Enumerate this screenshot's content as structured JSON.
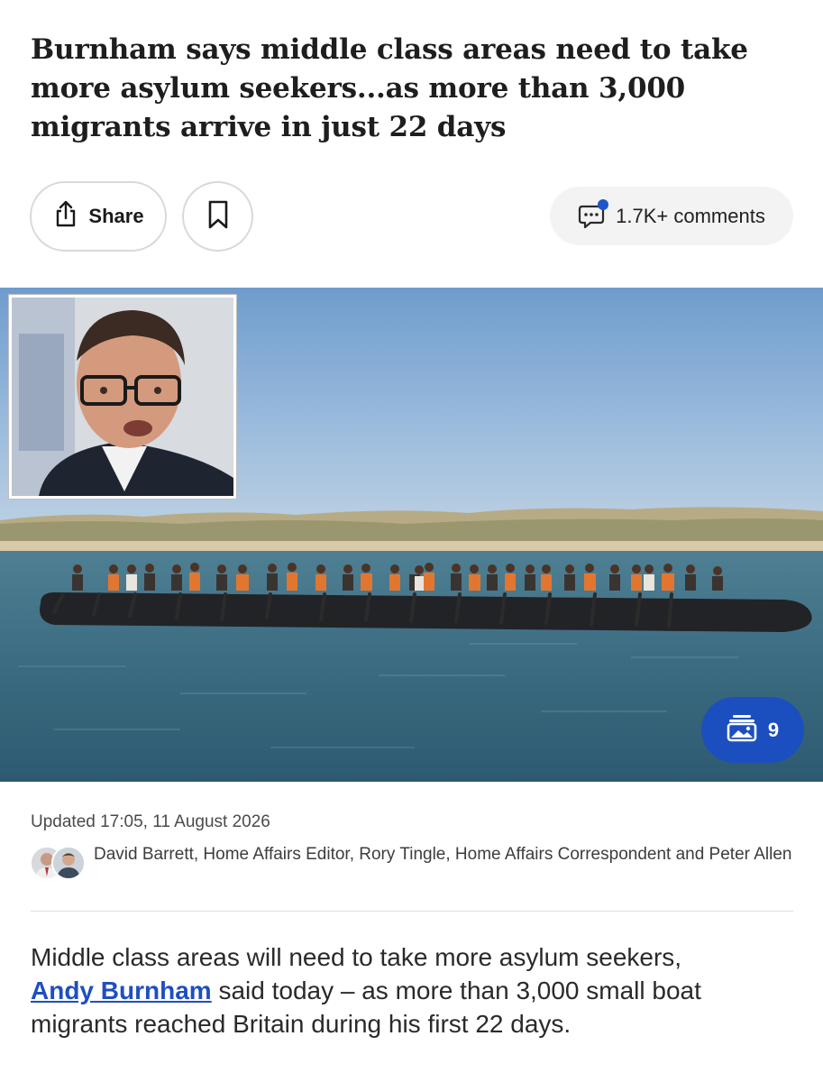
{
  "article": {
    "headline": "Burnham says middle class areas need to take more asylum seekers...as more than 3,000 migrants arrive in just 22 days",
    "updated": "Updated 17:05, 11 August 2026",
    "byline": "David Barrett, Home Affairs Editor, Rory Tingle, Home Affairs Correspondent and Peter Allen",
    "body_intro": "Middle class areas will need to take more asylum seekers,",
    "body_link": "Andy Burnham",
    "body_rest": " said today – as more than 3,000 small boat migrants reached Britain during his first 22 days."
  },
  "actions": {
    "share_label": "Share",
    "comments_label": "1.7K+ comments",
    "gallery_count": "9"
  },
  "icons": {
    "share": "share-icon",
    "bookmark": "bookmark-icon",
    "comment": "comment-icon",
    "gallery": "gallery-icon"
  },
  "colors": {
    "accent": "#1b4fbf",
    "link": "#1e4fc0",
    "notification_dot": "#1e55c8"
  }
}
